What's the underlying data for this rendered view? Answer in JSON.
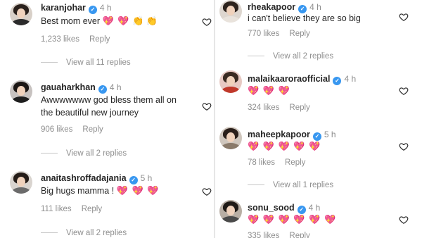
{
  "left": {
    "comments": [
      {
        "username": "karanjohar",
        "time": "4 h",
        "text": "Best mom ever",
        "emoji": "💖 💖",
        "emoji2": "👏 👏",
        "likes": "1,233 likes",
        "reply": "Reply",
        "view_replies": "View all 11 replies"
      },
      {
        "username": "gauaharkhan",
        "time": "4 h",
        "text_line1": "Awwwwwww god bless them all on",
        "text_line2": "the beautiful new journey",
        "likes": "906 likes",
        "reply": "Reply",
        "view_replies": "View all 2 replies"
      },
      {
        "username": "anaitashroffadajania",
        "time": "5 h",
        "text": "Big hugs mamma !",
        "emoji": "💖 💖 💖",
        "likes": "111 likes",
        "reply": "Reply",
        "view_replies": "View all 2 replies"
      }
    ]
  },
  "right": {
    "comments": [
      {
        "username": "rheakapoor",
        "time": "4 h",
        "text": "i can't believe they are so big",
        "likes": "770 likes",
        "reply": "Reply",
        "view_replies": "View all 2 replies"
      },
      {
        "username": "malaikaarora",
        "username_suffix": "official",
        "time": "4 h",
        "emoji": "💖 💖 💖",
        "likes": "324 likes",
        "reply": "Reply"
      },
      {
        "username": "maheepkapoor",
        "time": "5 h",
        "emoji": "💖 💖 💖 💖 💖",
        "likes": "78 likes",
        "reply": "Reply",
        "view_replies": "View all 1 replies"
      },
      {
        "username": "sonu_sood",
        "time": "4 h",
        "emoji": "💖 💖 💖 💖 💖 💖",
        "likes": "335 likes",
        "reply": "Reply"
      }
    ]
  },
  "colors": {
    "verified": "#3897f0",
    "muted": "#8e8e8e",
    "heart": "#ed4956"
  },
  "icons": {
    "like": "heart-outline-icon",
    "verified": "verified-badge-icon"
  }
}
